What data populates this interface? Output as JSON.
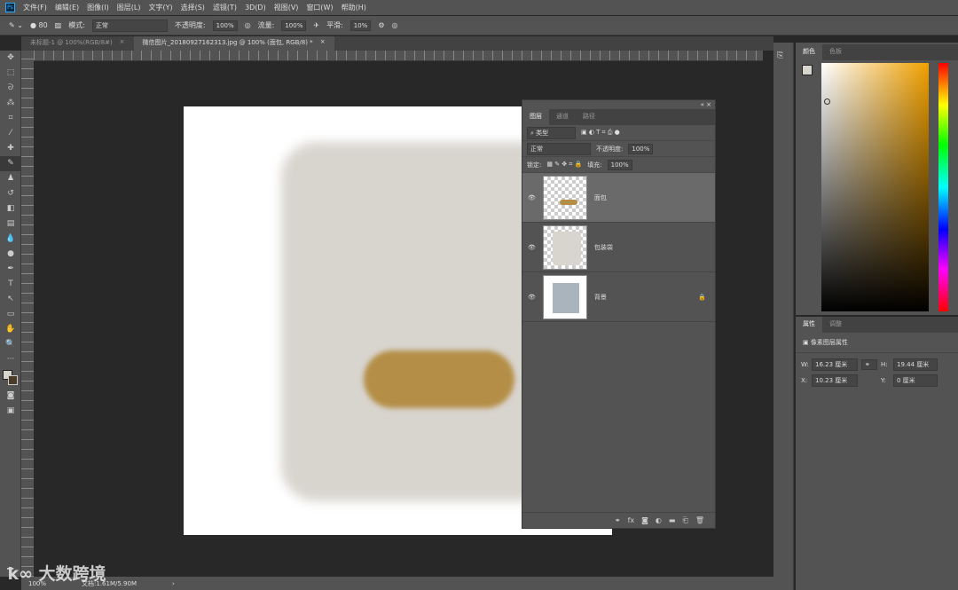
{
  "menu": {
    "items": [
      "文件(F)",
      "编辑(E)",
      "图像(I)",
      "图层(L)",
      "文字(Y)",
      "选择(S)",
      "滤镜(T)",
      "3D(D)",
      "视图(V)",
      "窗口(W)",
      "帮助(H)"
    ]
  },
  "options": {
    "brush_size": "80",
    "mode_label": "模式:",
    "mode_value": "正常",
    "opacity_label": "不透明度:",
    "opacity_value": "100%",
    "flow_label": "流量:",
    "flow_value": "100%",
    "smooth_label": "平滑:",
    "smooth_value": "10%"
  },
  "tabs": [
    {
      "label": "未标题-1 @ 100%(RGB/8#)"
    },
    {
      "label": "微信图片_20180927162313.jpg @ 100% (面包, RGB/8) *"
    }
  ],
  "layers_panel": {
    "tabs": [
      "图层",
      "通道",
      "路径"
    ],
    "filter_kind": "类型",
    "blend_mode": "正常",
    "opacity_label": "不透明度:",
    "opacity_value": "100%",
    "lock_label": "锁定:",
    "fill_label": "填充:",
    "fill_value": "100%",
    "layers": [
      {
        "name": "面包",
        "selected": true
      },
      {
        "name": "包装袋",
        "selected": false
      },
      {
        "name": "背景",
        "selected": false,
        "locked": true
      }
    ]
  },
  "color_panel": {
    "tabs": [
      "颜色",
      "色板"
    ],
    "foreground": "#d8d4ce",
    "hue_color": "#f0a000"
  },
  "properties_panel": {
    "tabs": [
      "属性",
      "调整"
    ],
    "title": "像素图层属性",
    "w_label": "W:",
    "w_value": "16.23 厘米",
    "h_label": "H:",
    "h_value": "19.44 厘米",
    "x_label": "X:",
    "x_value": "10.23 厘米",
    "y_label": "Y:",
    "y_value": "0 厘米"
  },
  "status": {
    "zoom": "100%",
    "doc": "文档:1.61M/5.90M"
  },
  "watermark": "大数跨境"
}
